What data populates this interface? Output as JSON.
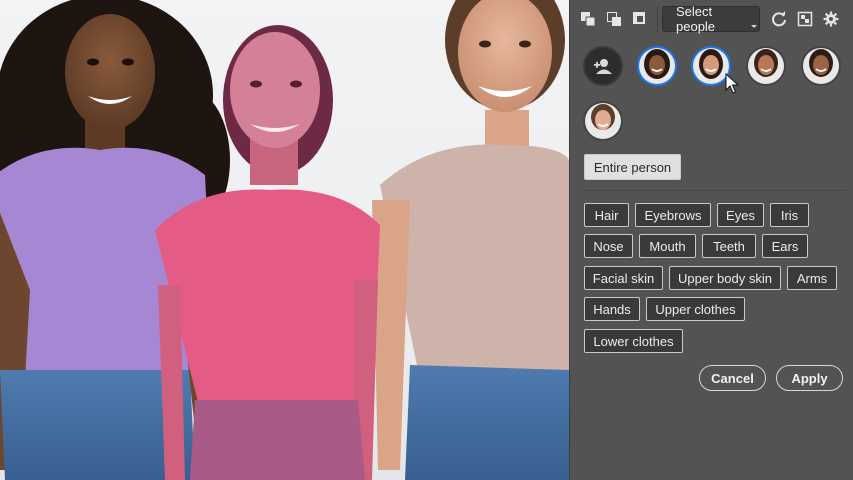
{
  "toolbar": {
    "icons": [
      "copy-stack-icon",
      "copy-front-icon",
      "subtract-icon",
      "refresh-icon",
      "mask-grid-icon",
      "gear-icon"
    ],
    "select_people_label": "Select people"
  },
  "people": {
    "add_icon": "add-person-icon",
    "avatars": [
      {
        "name": "person-1",
        "selected": true
      },
      {
        "name": "person-2",
        "selected": true
      },
      {
        "name": "person-3",
        "selected": false
      },
      {
        "name": "person-4",
        "selected": false
      },
      {
        "name": "person-5",
        "selected": false
      }
    ]
  },
  "entire_person_label": "Entire person",
  "parts": [
    "Hair",
    "Eyebrows",
    "Eyes",
    "Iris",
    "Nose",
    "Mouth",
    "Teeth",
    "Ears",
    "Facial skin",
    "Upper body skin",
    "Arms",
    "Hands",
    "Upper clothes",
    "Lower clothes"
  ],
  "actions": {
    "cancel_label": "Cancel",
    "apply_label": "Apply"
  },
  "colors": {
    "selection_accent": "#1877f2",
    "mask_overlay": "#d94a7a",
    "panel_bg": "#535353"
  }
}
